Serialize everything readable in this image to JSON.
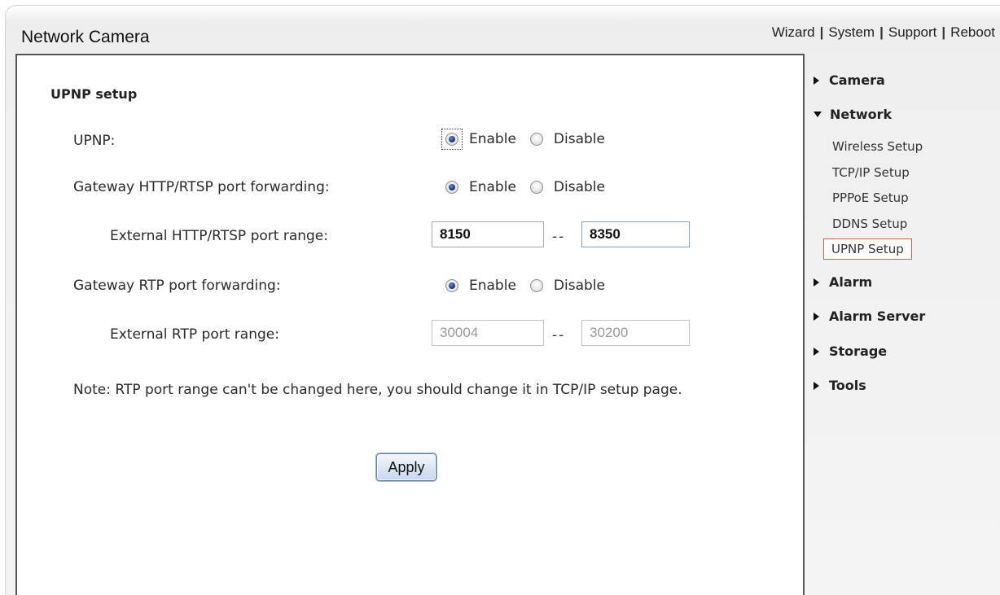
{
  "header": {
    "title": "Network Camera",
    "nav": [
      "Wizard",
      "System",
      "Support",
      "Reboot"
    ]
  },
  "form": {
    "section_title": "UPNP setup",
    "upnp": {
      "label": "UPNP:",
      "enable": "Enable",
      "disable": "Disable",
      "selected": "Enable"
    },
    "gateway_http": {
      "label": "Gateway HTTP/RTSP port forwarding:",
      "enable": "Enable",
      "disable": "Disable",
      "selected": "Enable"
    },
    "external_http": {
      "label": "External HTTP/RTSP port range:",
      "from": "8150",
      "separator": "--",
      "to": "8350"
    },
    "gateway_rtp": {
      "label": "Gateway RTP port forwarding:",
      "enable": "Enable",
      "disable": "Disable",
      "selected": "Enable"
    },
    "external_rtp": {
      "label": "External RTP port range:",
      "from": "30004",
      "separator": "--",
      "to": "30200",
      "disabled": true
    },
    "note": "Note: RTP port range can't be changed here, you should change it in TCP/IP setup page.",
    "apply_label": "Apply"
  },
  "sidebar": {
    "camera": "Camera",
    "network": "Network",
    "network_items": [
      "Wireless Setup",
      "TCP/IP Setup",
      "PPPoE Setup",
      "DDNS Setup",
      "UPNP Setup"
    ],
    "active_item": "UPNP Setup",
    "alarm": "Alarm",
    "alarm_server": "Alarm Server",
    "storage": "Storage",
    "tools": "Tools"
  },
  "colors": {
    "radio_selected": "#1d3f86",
    "active_item_border": "#e55353",
    "button_border": "#5f7fa7"
  }
}
